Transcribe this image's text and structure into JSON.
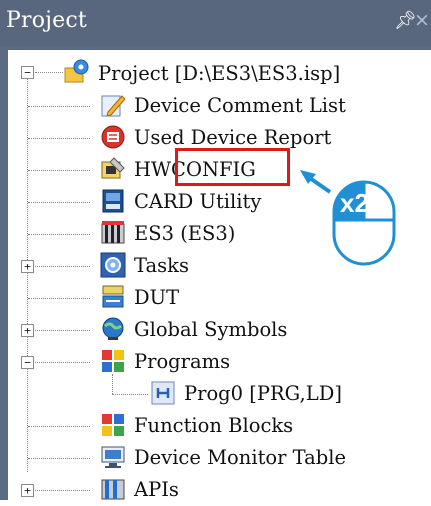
{
  "panel": {
    "title": "Project",
    "pin_icon": "pin-icon",
    "close_icon": "close-icon"
  },
  "tree": {
    "items": [
      {
        "label": "Project [D:\\ES3\\ES3.isp]",
        "icon": "project-gear-icon",
        "expander": "−"
      },
      {
        "label": "Device Comment List",
        "icon": "edit-pencil-icon"
      },
      {
        "label": "Used Device Report",
        "icon": "report-icon"
      },
      {
        "label": "HWCONFIG",
        "icon": "hardware-config-icon"
      },
      {
        "label": "CARD Utility",
        "icon": "card-icon"
      },
      {
        "label": "ES3  (ES3)",
        "icon": "plc-icon"
      },
      {
        "label": "Tasks",
        "icon": "tasks-icon",
        "expander": "+"
      },
      {
        "label": "DUT",
        "icon": "dut-icon"
      },
      {
        "label": "Global Symbols",
        "icon": "global-symbols-icon",
        "expander": "+"
      },
      {
        "label": "Programs",
        "icon": "programs-icon",
        "expander": "−"
      },
      {
        "label": "Prog0 [PRG,LD]",
        "icon": "program-file-icon"
      },
      {
        "label": "Function Blocks",
        "icon": "function-blocks-icon"
      },
      {
        "label": "Device Monitor Table",
        "icon": "monitor-table-icon"
      },
      {
        "label": "APIs",
        "icon": "apis-icon",
        "expander": "+"
      }
    ]
  },
  "annotation": {
    "click_count_label": "x2",
    "highlight_color": "#e01818",
    "arrow_color": "#1f8fd6"
  }
}
